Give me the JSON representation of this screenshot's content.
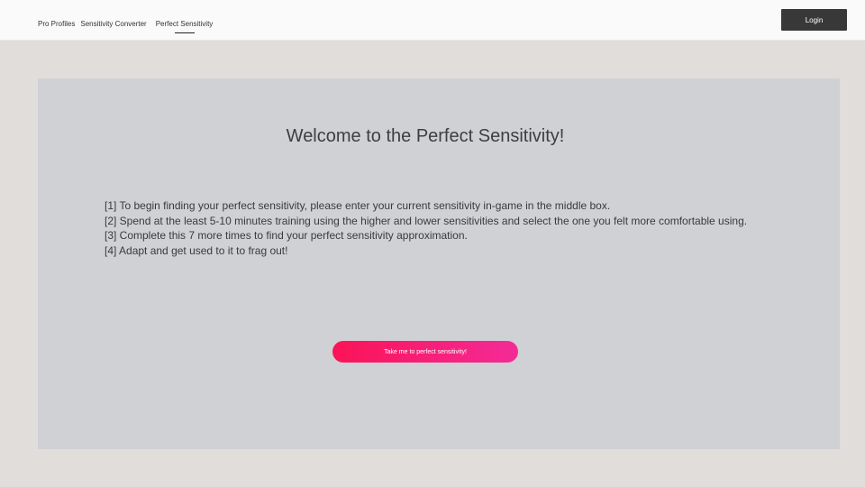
{
  "nav": {
    "items": [
      {
        "label": "Pro Profiles"
      },
      {
        "label": "Sensitivity Converter"
      },
      {
        "label": "Perfect Sensitivity"
      }
    ],
    "active": "Perfect Sensitivity"
  },
  "header": {
    "login_label": "Login"
  },
  "main": {
    "title": "Welcome to the Perfect Sensitivity!",
    "steps": [
      "[1] To begin finding your perfect sensitivity, please enter your current sensitivity in-game in the middle box.",
      "[2] Spend at the least 5-10 minutes training using the higher and lower sensitivities and select the one you felt more comfortable using.",
      "[3] Complete this 7 more times to find your perfect sensitivity approximation.",
      "[4] Adapt and get used to it to frag out!"
    ],
    "cta_label": "Take me to perfect sensitivity!"
  },
  "colors": {
    "page_background": "#e1dddb",
    "panel_background": "#d0d1d5",
    "login_button": "#383838",
    "cta_gradient_start": "#fb1357",
    "cta_gradient_end": "#f32b97"
  }
}
